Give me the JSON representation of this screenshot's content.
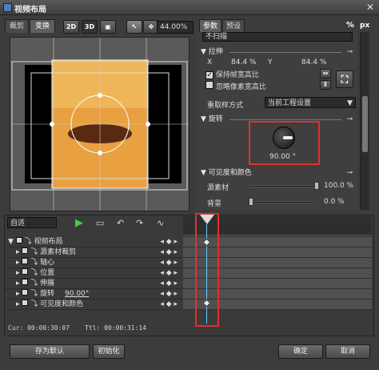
{
  "window": {
    "title": "视频布局",
    "close": "✕"
  },
  "left_tabs": [
    "裁剪",
    "变换"
  ],
  "toolbar": {
    "btn_2d": "2D",
    "btn_3d": "3D",
    "zoom": "44.00%"
  },
  "right_tabs": [
    "参数",
    "预设"
  ],
  "right_icons": {
    "percent": "%",
    "px": "px"
  },
  "params": {
    "first_combo": "不扫描",
    "stretch": {
      "title": "拉伸",
      "x_label": "X",
      "x_value": "84.4 %",
      "y_label": "Y",
      "y_value": "84.4 %"
    },
    "keep_ratio": "保持帧宽高比",
    "ignore_pixel": "忽略像素宽高比",
    "resample_label": "重取样方式",
    "resample_value": "当前工程设置",
    "rotation": {
      "title": "旋转",
      "value": "90.00 °"
    },
    "visibility": {
      "title": "可见度和颜色",
      "source_label": "源素材",
      "source_value": "100.0 %",
      "bg_label": "背景",
      "bg_value": "0.0 %"
    }
  },
  "timeline": {
    "mode": "自适",
    "tracks": [
      {
        "label": "视频布局",
        "value": ""
      },
      {
        "label": "源素材裁剪",
        "value": ""
      },
      {
        "label": "轴心",
        "value": ""
      },
      {
        "label": "位置",
        "value": ""
      },
      {
        "label": "伸展",
        "value": ""
      },
      {
        "label": "旋转",
        "value": "90.00°"
      },
      {
        "label": "可见度和颜色",
        "value": ""
      }
    ],
    "cur": "Cur: 00:00:30:07",
    "ttl": "Ttl: 00:00:31:14"
  },
  "buttons": {
    "save_default": "存为默认",
    "initialize": "初始化",
    "ok": "确定",
    "cancel": "取消"
  }
}
